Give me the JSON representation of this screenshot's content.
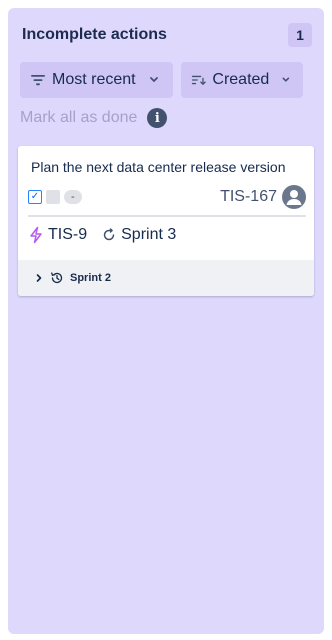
{
  "panel": {
    "title": "Incomplete actions",
    "count": "1",
    "background": "#dfd8fd"
  },
  "filters": {
    "sort_label": "Most recent",
    "sort_icon": "filter-lines-icon",
    "field_label": "Created",
    "field_icon": "sort-descending-icon"
  },
  "mark_all": {
    "label": "Mark all as done",
    "info_icon": "info-icon"
  },
  "card": {
    "summary": "Plan the next data center release version",
    "status_dash": "-",
    "issue_key": "TIS-167",
    "linked_issue": "TIS-9",
    "sprint": "Sprint 3",
    "footer_sprint": "Sprint 2",
    "accent_purple": "#b65cf0"
  }
}
